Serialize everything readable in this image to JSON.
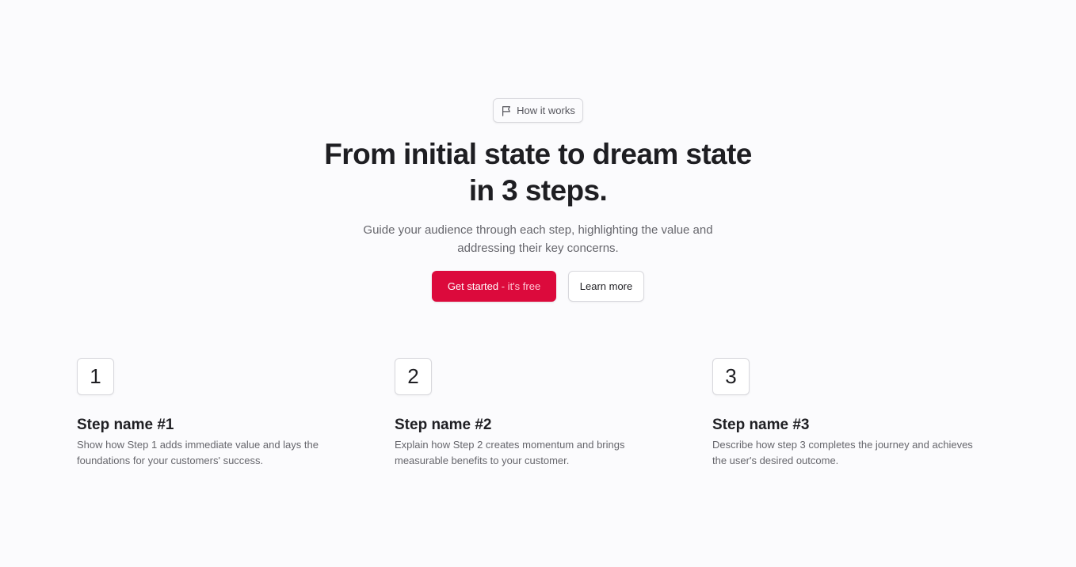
{
  "badge": {
    "icon": "flag-icon",
    "label": "How it works"
  },
  "hero": {
    "title": "From initial state to dream state in 3 steps.",
    "subtitle": "Guide your audience through each step, highlighting the value and addressing their key concerns."
  },
  "cta": {
    "primary_main": "Get started",
    "primary_suffix": " - it's free",
    "secondary": "Learn more"
  },
  "steps": [
    {
      "number": "1",
      "title": "Step name #1",
      "description": "Show how Step 1 adds immediate value and lays the foundations for your customers' success."
    },
    {
      "number": "2",
      "title": "Step name #2",
      "description": "Explain how Step 2 creates momentum and brings measurable benefits to your customer."
    },
    {
      "number": "3",
      "title": "Step name #3",
      "description": "Describe how step 3 completes the journey and achieves the user's desired outcome."
    }
  ],
  "colors": {
    "background": "#fbfbfd",
    "accent": "#dc0a3c",
    "text": "#1f1f23",
    "muted_text": "#66666c",
    "border": "#d8d8dd"
  }
}
